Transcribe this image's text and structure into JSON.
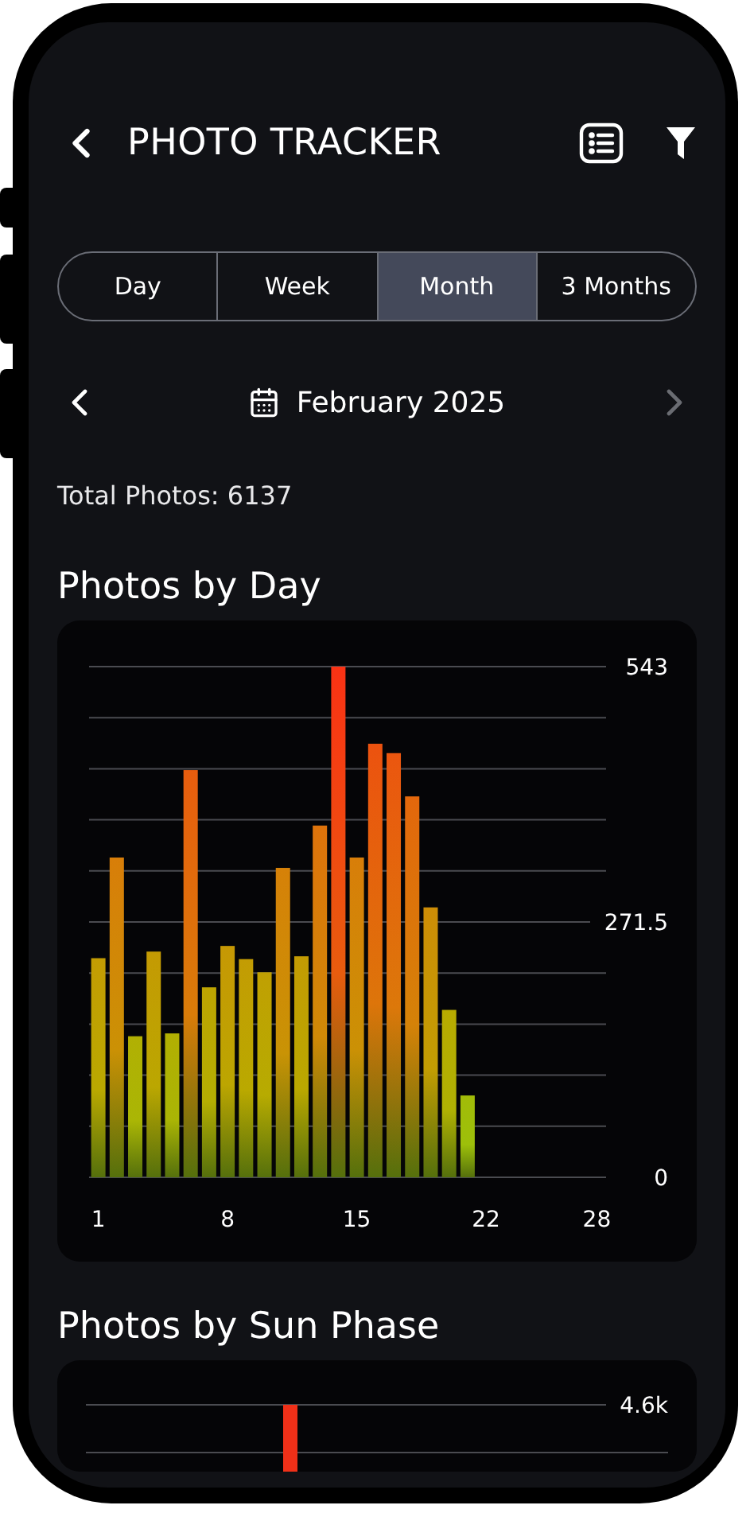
{
  "header": {
    "title": "PHOTO TRACKER"
  },
  "tabs": [
    {
      "label": "Day",
      "selected": false
    },
    {
      "label": "Week",
      "selected": false
    },
    {
      "label": "Month",
      "selected": true
    },
    {
      "label": "3 Months",
      "selected": false
    }
  ],
  "date_nav": {
    "label": "February 2025",
    "next_disabled": true
  },
  "total": "Total Photos: 6137",
  "sections": [
    {
      "title": "Photos by Day",
      "chart_data": {
        "type": "bar",
        "x": [
          1,
          2,
          3,
          4,
          5,
          6,
          7,
          8,
          9,
          10,
          11,
          12,
          13,
          14,
          15,
          16,
          17,
          18,
          19,
          20,
          21
        ],
        "series": [
          {
            "values": [
              233,
              340,
              150,
              240,
              153,
              433,
              202,
              246,
              232,
              218,
              329,
              235,
              374,
              543,
              340,
              461,
              451,
              405,
              287,
              178,
              87
            ]
          }
        ],
        "xlim": [
          0.5,
          28.5
        ],
        "ylim": [
          0,
          543
        ],
        "yticks": [
          0,
          271.5,
          543
        ],
        "xticks": [
          1,
          8,
          15,
          22,
          28
        ]
      }
    },
    {
      "title": "Photos by Sun Phase",
      "partial_chart": {
        "tick_label": "4.6k"
      }
    }
  ]
}
